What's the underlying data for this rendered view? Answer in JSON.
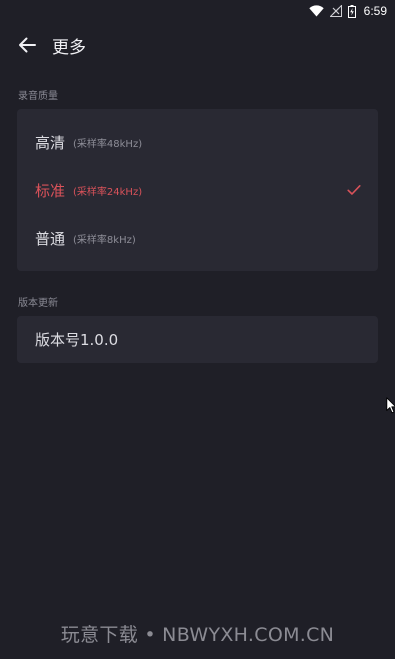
{
  "status_bar": {
    "time": "6:59",
    "icons": [
      "wifi-icon",
      "signal-off-icon",
      "battery-charging-icon"
    ]
  },
  "header": {
    "title": "更多",
    "back_icon": "arrow-left-icon"
  },
  "recording_quality": {
    "section_label": "录音质量",
    "options": [
      {
        "name": "高清",
        "desc": "(采样率48kHz)",
        "selected": false
      },
      {
        "name": "标准",
        "desc": "(采样率24kHz)",
        "selected": true
      },
      {
        "name": "普通",
        "desc": "(采样率8kHz)",
        "selected": false
      }
    ]
  },
  "version_update": {
    "section_label": "版本更新",
    "version_text": "版本号1.0.0"
  },
  "watermark": "玩意下载 • NBWYXH.COM.CN",
  "colors": {
    "background": "#1f1f27",
    "card": "#292933",
    "accent": "#d9525a"
  }
}
